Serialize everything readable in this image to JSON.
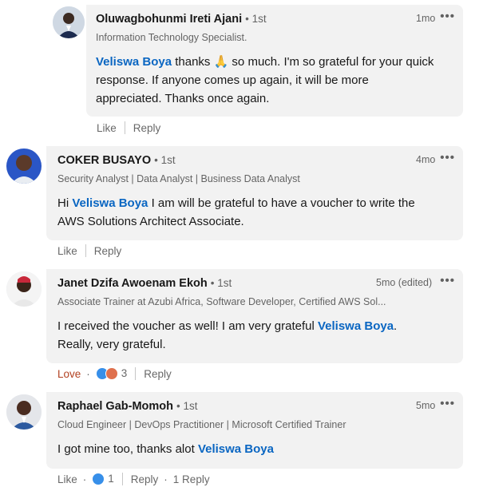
{
  "comments": [
    {
      "name": "Oluwagbohunmi Ireti Ajani",
      "degree": "• 1st",
      "headline": "Information Technology Specialist.",
      "time": "1mo",
      "more": "•••",
      "body": {
        "mention": "Veliswa Boya",
        "line1_rest": " thanks 🙏 so much. I'm so grateful for your quick",
        "line2": "response. If anyone comes up again, it will be more",
        "line3": "appreciated. Thanks once again."
      },
      "actions": {
        "like": "Like",
        "reply": "Reply"
      }
    },
    {
      "name": "COKER BUSAYO",
      "degree": "• 1st",
      "headline": "Security Analyst | Data Analyst | Business Data Analyst",
      "time": "4mo",
      "more": "•••",
      "body": {
        "prefix": "Hi ",
        "mention": "Veliswa Boya",
        "line1_rest": " I am will be grateful to have a voucher to write the",
        "line2": "AWS Solutions Architect Associate."
      },
      "actions": {
        "like": "Like",
        "reply": "Reply"
      }
    },
    {
      "name": "Janet Dzifa Awoenam Ekoh",
      "degree": "• 1st",
      "headline": "Associate Trainer at Azubi Africa, Software Developer, Certified AWS Sol...",
      "time": "5mo (edited)",
      "more": "•••",
      "body": {
        "line1_prefix": "I received the voucher as well! I am very grateful ",
        "mention": "Veliswa Boya",
        "line1_suffix": ".",
        "line2": "Really, very grateful."
      },
      "actions": {
        "like": "Love",
        "separator": "·",
        "reaction_count": "3",
        "reply": "Reply"
      }
    },
    {
      "name": "Raphael Gab-Momoh",
      "degree": "• 1st",
      "headline": "Cloud Engineer | DevOps Practitioner | Microsoft Certified Trainer",
      "time": "5mo",
      "more": "•••",
      "body": {
        "line1_prefix": "I got mine too, thanks alot ",
        "mention": "Veliswa Boya"
      },
      "actions": {
        "like": "Like",
        "separator": "·",
        "reaction_count": "1",
        "reply": "Reply",
        "separator2": "·",
        "replies": "1 Reply"
      }
    }
  ],
  "colors": {
    "link": "#0a66c2",
    "love": "#b24020",
    "bubble": "#f2f2f2",
    "like_reaction": "#378fe9",
    "love_reaction": "#df704d"
  },
  "icons": [
    "avatar",
    "like-reaction-icon",
    "love-reaction-icon",
    "more-options-icon"
  ]
}
